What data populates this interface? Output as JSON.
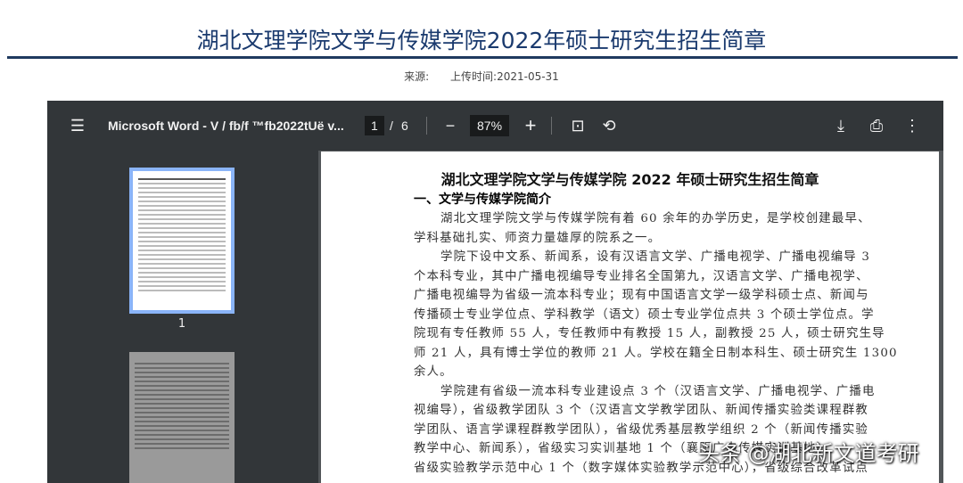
{
  "article": {
    "title": "湖北文理学院文学与传媒学院2022年硕士研究生招生简章",
    "source_label": "来源:",
    "upload_label": "上传时间:",
    "upload_date": "2021-05-31"
  },
  "viewer": {
    "file_name": "Microsoft Word - V / fb/f  ™fb2022tUë v...",
    "current_page": "1",
    "page_sep": "/",
    "total_pages": "6",
    "zoom": "87%",
    "thumb_label": "1"
  },
  "document": {
    "title": "湖北文理学院文学与传媒学院 2022 年硕士研究生招生简章",
    "section": "一、文学与传媒学院简介",
    "lines": [
      {
        "t": "湖北文理学院文学与传媒学院有着 60 余年的办学历史，是学校创建最早、",
        "i": true
      },
      {
        "t": "学科基础扎实、师资力量雄厚的院系之一。",
        "i": false
      },
      {
        "t": "学院下设中文系、新闻系，设有汉语言文学、广播电视学、广播电视编导 3",
        "i": true
      },
      {
        "t": "个本科专业，其中广播电视编导专业排名全国第九，汉语言文学、广播电视学、",
        "i": false
      },
      {
        "t": "广播电视编导为省级一流本科专业；现有中国语言文学一级学科硕士点、新闻与",
        "i": false
      },
      {
        "t": "传播硕士专业学位点、学科教学（语文）硕士专业学位点共 3 个硕士学位点。学",
        "i": false
      },
      {
        "t": "院现有专任教师 55 人，专任教师中有教授 15 人，副教授 25 人，硕士研究生导",
        "i": false
      },
      {
        "t": "师 21 人，具有博士学位的教师 21 人。学校在籍全日制本科生、硕士研究生 1300",
        "i": false
      },
      {
        "t": "余人。",
        "i": false
      },
      {
        "t": "学院建有省级一流本科专业建设点 3 个（汉语言文学、广播电视学、广播电",
        "i": true
      },
      {
        "t": "视编导），省级教学团队 3 个（汉语言文学教学团队、新闻传播实验类课程群教",
        "i": false
      },
      {
        "t": "学团队、语言学课程群教学团队），省级优秀基层教学组织 2 个（新闻传播实验",
        "i": false
      },
      {
        "t": "教学中心、新闻系），省级实习实训基地 1 个（襄阳广电传媒实训基地），",
        "i": false
      },
      {
        "t": "省级实验教学示范中心 1 个（数字媒体实验教学示范中心），省级综合改革试点",
        "i": false
      }
    ]
  },
  "watermark": "头条 @湖北新文道考研"
}
